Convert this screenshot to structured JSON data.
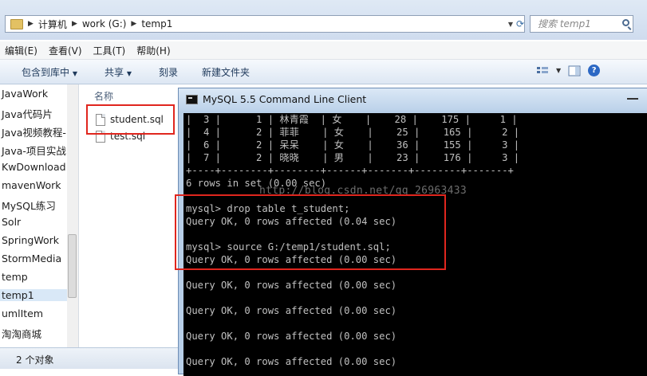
{
  "explorer": {
    "breadcrumb": [
      "计算机",
      "work (G:)",
      "temp1"
    ],
    "search_placeholder": "搜索 temp1",
    "menu": [
      "编辑(E)",
      "查看(V)",
      "工具(T)",
      "帮助(H)"
    ],
    "toolbar": {
      "include_library": "包含到库中",
      "share": "共享",
      "burn": "刻录",
      "new_folder": "新建文件夹"
    },
    "nav_items": [
      "JavaWork",
      "Java代码片",
      "Java视频教程-",
      "Java-项目实战",
      "KwDownload",
      "mavenWork",
      "MySQL练习",
      "Solr",
      "SpringWork",
      "StormMedia",
      "temp",
      "temp1",
      "umlItem",
      "淘淘商城"
    ],
    "nav_selected": "temp1",
    "column_name": "名称",
    "files": [
      "student.sql",
      "test.sql"
    ],
    "status": "2 个对象"
  },
  "console": {
    "title": "MySQL 5.5 Command Line Client",
    "lines": [
      "|  3 |      1 | 林青霞  | 女    |    28 |    175 |     1 |",
      "|  4 |      2 | 菲菲    | 女    |    25 |    165 |     2 |",
      "|  6 |      2 | 呆呆    | 女    |    36 |    155 |     3 |",
      "|  7 |      2 | 晓晓    | 男    |    23 |    176 |     3 |",
      "+----+--------+--------+------+-------+--------+-------+",
      "6 rows in set (0.00 sec)",
      "",
      "mysql> drop table t_student;",
      "Query OK, 0 rows affected (0.04 sec)",
      "",
      "mysql> source G:/temp1/student.sql;",
      "Query OK, 0 rows affected (0.00 sec)",
      "",
      "Query OK, 0 rows affected (0.00 sec)",
      "",
      "Query OK, 0 rows affected (0.00 sec)",
      "",
      "Query OK, 0 rows affected (0.00 sec)",
      "",
      "Query OK, 0 rows affected (0.00 sec)"
    ],
    "watermark": "http://blog.csdn.net/qq_26963433"
  }
}
